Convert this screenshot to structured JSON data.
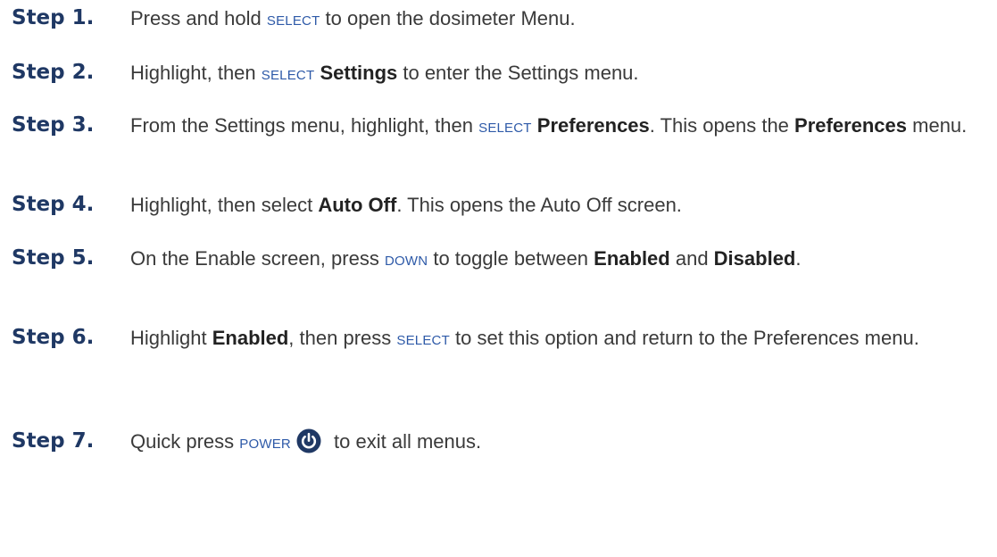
{
  "steps": [
    {
      "label": "Step 1.",
      "t1": "Press and hold ",
      "k1": "SELECT",
      "t2": " to open the dosimeter Menu."
    },
    {
      "label": "Step 2.",
      "t1": "Highlight, then ",
      "k1": "SELECT",
      "t2": " ",
      "b1": "Settings",
      "t3": " to enter the Settings menu."
    },
    {
      "label": "Step 3.",
      "t1": "From the Settings menu, highlight, then ",
      "k1": "SELECT",
      "t2": " ",
      "b1": "Preferences",
      "t3": ". This opens the ",
      "b2": "Preferences",
      "t4": " menu."
    },
    {
      "label": "Step 4.",
      "t1": "Highlight, then select ",
      "b1": "Auto Off",
      "t2": ". This opens the Auto Off screen."
    },
    {
      "label": "Step 5.",
      "t1": "On the Enable screen, press ",
      "k1": "DOWN",
      "t2": " to toggle between ",
      "b1": "Enabled",
      "t3": " and ",
      "b2": "Disabled",
      "t4": "."
    },
    {
      "label": "Step 6.",
      "t1": "Highlight ",
      "b1": "Enabled",
      "t2": ", then press ",
      "k1": "SELECT",
      "t3": " to set this option and return to the Preferences menu."
    },
    {
      "label": "Step 7.",
      "t1": "Quick press ",
      "k1": "POWER",
      "icon": "power-icon",
      "t2": " to exit all menus."
    }
  ],
  "colors": {
    "step_label": "#1f3864",
    "key_text": "#2e5aa8",
    "body_text": "#3a3a3a",
    "icon_fill": "#1f3864"
  }
}
